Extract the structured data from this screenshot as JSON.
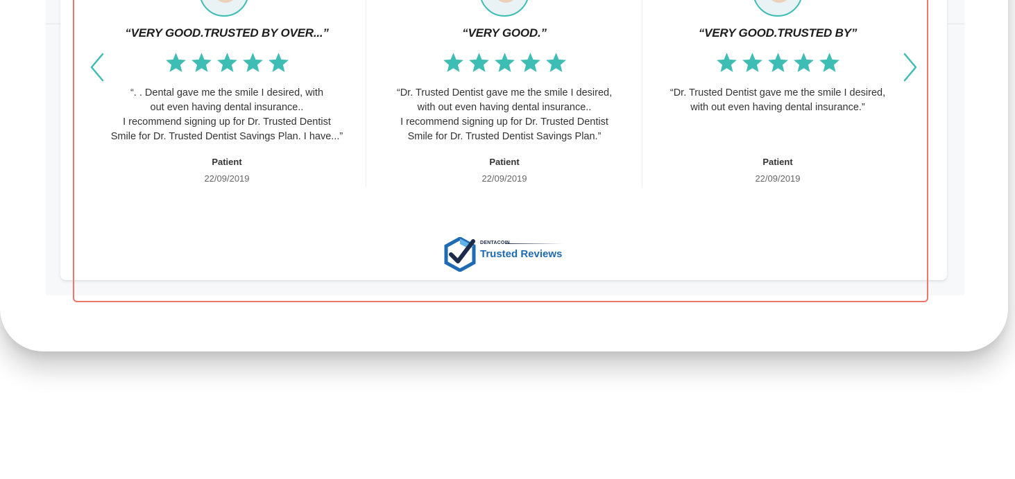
{
  "colors": {
    "accent_teal": "#3dbdb3",
    "frame_red": "#f0756a",
    "badge_blue": "#1e6ab3",
    "badge_navy": "#1d2b4a"
  },
  "carousel": {
    "prev_icon": "chevron-left-icon",
    "next_icon": "chevron-right-icon"
  },
  "reviews": [
    {
      "title": "“VERY GOOD.TRUSTED BY OVER...”",
      "rating": 5,
      "text": "“. . Dental gave me the smile I desired, with\nout even having dental insurance..\nI recommend signing up for Dr. Trusted Dentist\nSmile for Dr. Trusted Dentist Savings Plan. I have...”",
      "author": "Patient",
      "date": "22/09/2019"
    },
    {
      "title": "“VERY GOOD.”",
      "rating": 5,
      "text": "“Dr. Trusted Dentist gave me the smile I desired,\nwith out even having dental insurance..\nI recommend signing up for Dr. Trusted Dentist\nSmile for Dr. Trusted Dentist Savings Plan.”",
      "author": "Patient",
      "date": "22/09/2019"
    },
    {
      "title": "“VERY GOOD.TRUSTED BY”",
      "rating": 5,
      "text": "“Dr. Trusted Dentist gave me the smile I desired,\nwith out even having dental insurance.”",
      "author": "Patient",
      "date": "22/09/2019"
    }
  ],
  "badge": {
    "brand_small": "DENTACOIN",
    "label": "Trusted Reviews",
    "icon": "checkmark-shield-icon"
  }
}
